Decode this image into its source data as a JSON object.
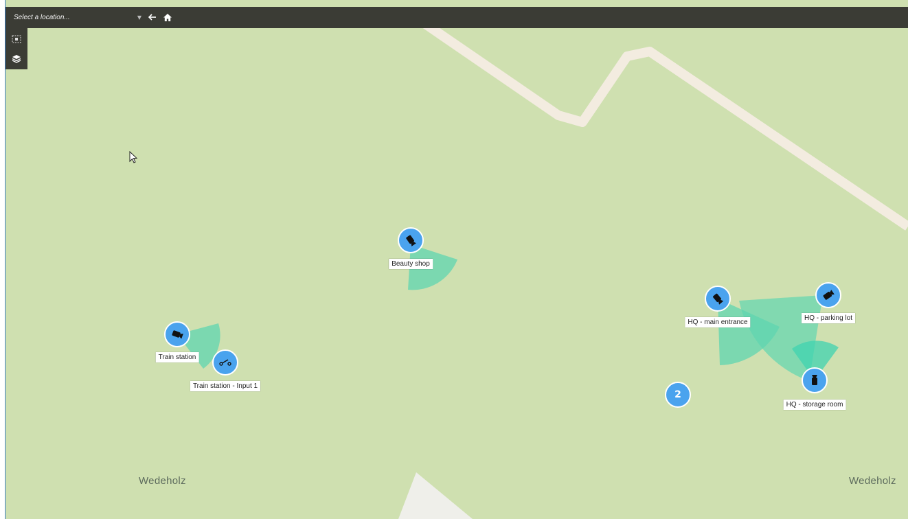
{
  "toolbar": {
    "location_placeholder": "Select a location...",
    "dropdown_icon": "chevron-down-icon",
    "back_icon": "arrow-left-icon",
    "home_icon": "home-icon"
  },
  "side_tools": [
    {
      "icon": "select-area-icon"
    },
    {
      "icon": "layers-icon"
    }
  ],
  "colors": {
    "land": "#cfe0b0",
    "road": "#f3ece0",
    "marker": "#4aa3ee",
    "field_of_view": "#5fd6b0",
    "toolbar": "#3b3c35"
  },
  "devices": [
    {
      "label": "Beauty shop",
      "icon": "camera-icon"
    },
    {
      "label": "Train station",
      "icon": "camera-icon"
    },
    {
      "label": "Train station - Input 1",
      "icon": "input-switch-icon"
    },
    {
      "label": "HQ - main entrance",
      "icon": "camera-icon"
    },
    {
      "label": "HQ - parking lot",
      "icon": "camera-icon"
    },
    {
      "label": "HQ - storage room",
      "icon": "camera-icon"
    }
  ],
  "cluster": {
    "count": "2"
  },
  "place_names": [
    "Wedeholz",
    "Wedeholz"
  ]
}
